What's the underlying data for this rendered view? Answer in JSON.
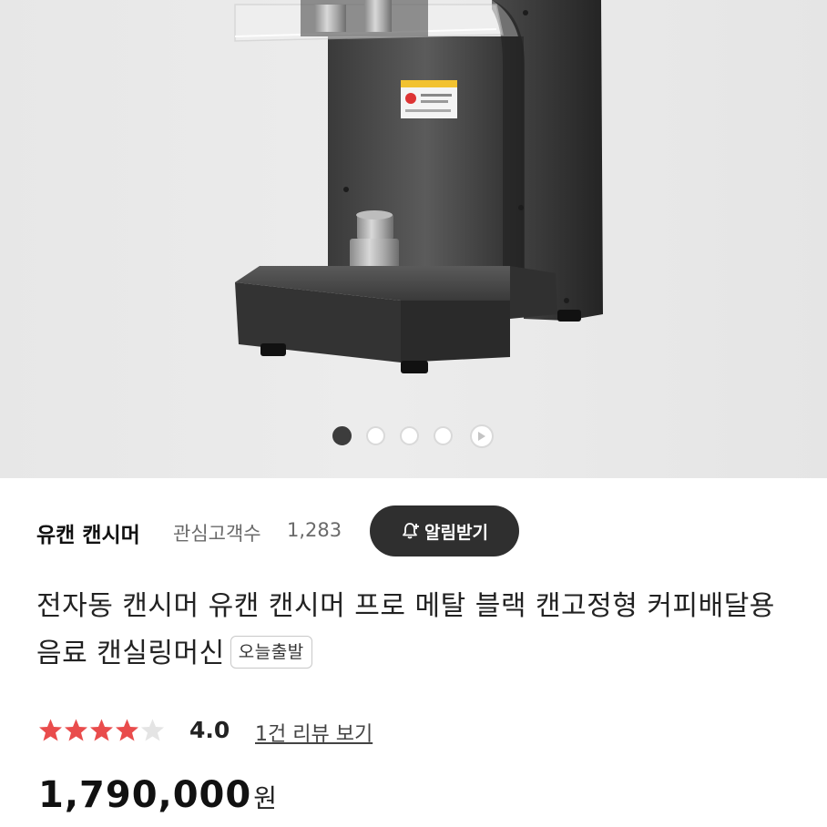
{
  "gallery": {
    "slide_count": 4,
    "active_index": 0,
    "has_play_button": true,
    "label_sticker_color": "#f2c230"
  },
  "shop": {
    "name": "유캔 캔시머",
    "favorites_label": "관심고객수",
    "favorites_count": "1,283",
    "alarm_button_label": "알림받기"
  },
  "product": {
    "title": "전자동 캔시머 유캔 캔시머 프로 메탈 블랙 캔고정형 커피배달용 음료 캔실링머신",
    "badge": "오늘출발",
    "rating": {
      "stars_filled": 4,
      "stars_total": 5,
      "value": "4.0",
      "review_link": "1건 리뷰 보기",
      "star_color": "#e94c4c"
    },
    "price": {
      "amount": "1,790,000",
      "unit": "원"
    }
  }
}
